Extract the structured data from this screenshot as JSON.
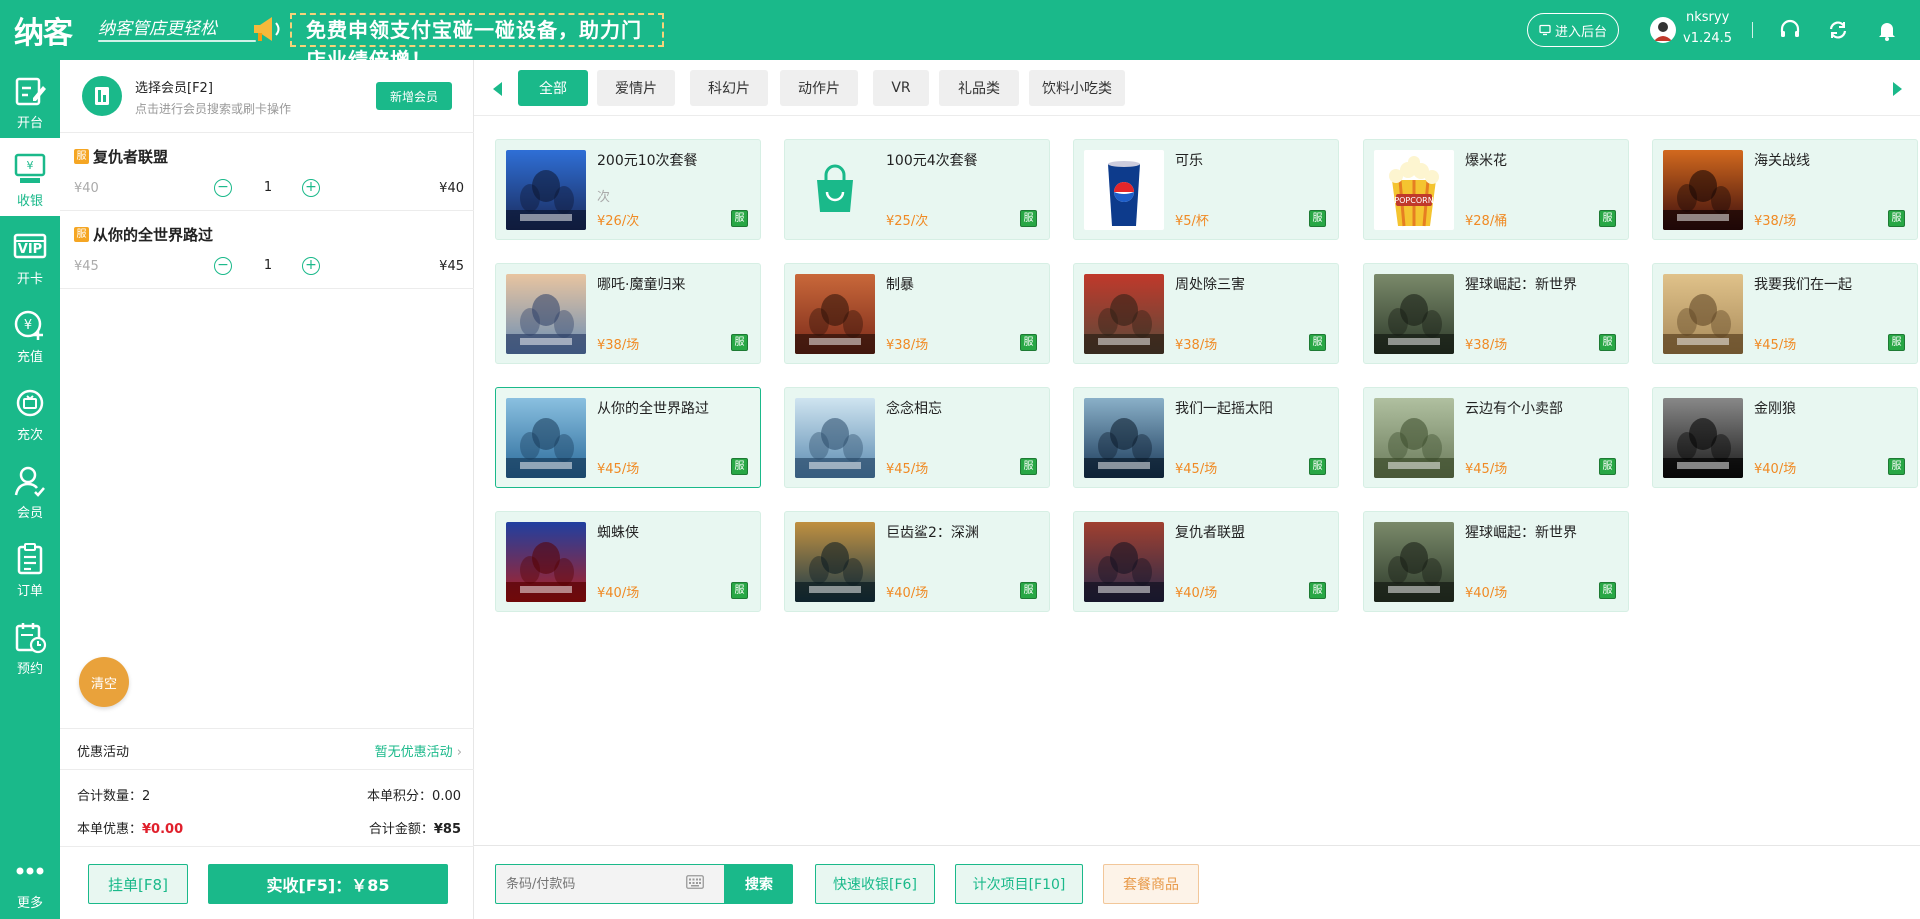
{
  "header": {
    "logo": "纳客",
    "slogan": "纳客管店更轻松",
    "banner": "免费申领支付宝碰一碰设备，助力门店业绩倍增！",
    "admin_button": "进入后台",
    "user_name": "nksryy",
    "version": "v1.24.5"
  },
  "sidebar": {
    "items": [
      {
        "label": "开台",
        "icon": "edit-icon"
      },
      {
        "label": "收银",
        "icon": "cashier-icon"
      },
      {
        "label": "开卡",
        "icon": "vip-icon"
      },
      {
        "label": "充值",
        "icon": "recharge-icon"
      },
      {
        "label": "充次",
        "icon": "recharge-count-icon"
      },
      {
        "label": "会员",
        "icon": "member-icon"
      },
      {
        "label": "订单",
        "icon": "order-icon"
      },
      {
        "label": "预约",
        "icon": "reservation-icon"
      },
      {
        "label": "更多",
        "icon": "more-icon"
      }
    ]
  },
  "cart": {
    "member_title": "选择会员[F2]",
    "member_sub": "点击进行会员搜索或刷卡操作",
    "add_member": "新增会员",
    "badge": "服",
    "items": [
      {
        "name": "复仇者联盟",
        "orig": "¥40",
        "qty": "1",
        "total": "¥40"
      },
      {
        "name": "从你的全世界路过",
        "orig": "¥45",
        "qty": "1",
        "total": "¥45"
      }
    ],
    "clear": "清空",
    "promo_label": "优惠活动",
    "promo_value": "暂无优惠活动",
    "total_qty_label": "合计数量：",
    "total_qty": "2",
    "points_label": "本单积分：",
    "points": "0.00",
    "discount_label": "本单优惠：",
    "discount": "¥0.00",
    "amount_label": "合计金额：",
    "amount": "¥85",
    "hold_button": "挂单[F8]",
    "pay_button": "实收[F5]：￥85"
  },
  "tabs": [
    "全部",
    "爱情片",
    "科幻片",
    "动作片",
    "VR",
    "礼品类",
    "饮料小吃类"
  ],
  "products": [
    {
      "name": "200元10次套餐",
      "sub": "次",
      "price": "¥26/次",
      "img": "arcade"
    },
    {
      "name": "100元4次套餐",
      "sub": "",
      "price": "¥25/次",
      "img": "bag"
    },
    {
      "name": "可乐",
      "sub": "",
      "price": "¥5/杯",
      "img": "cola"
    },
    {
      "name": "爆米花",
      "sub": "",
      "price": "¥28/桶",
      "img": "popcorn"
    },
    {
      "name": "海关战线",
      "sub": "",
      "price": "¥38/场",
      "img": "poster1"
    },
    {
      "name": "哪吒·魔童归来",
      "sub": "",
      "price": "¥38/场",
      "img": "poster2"
    },
    {
      "name": "制暴",
      "sub": "",
      "price": "¥38/场",
      "img": "poster3"
    },
    {
      "name": "周处除三害",
      "sub": "",
      "price": "¥38/场",
      "img": "poster4"
    },
    {
      "name": "猩球崛起：新世界",
      "sub": "",
      "price": "¥38/场",
      "img": "poster5"
    },
    {
      "name": "我要我们在一起",
      "sub": "",
      "price": "¥45/场",
      "img": "poster6"
    },
    {
      "name": "从你的全世界路过",
      "sub": "",
      "price": "¥45/场",
      "img": "poster7"
    },
    {
      "name": "念念相忘",
      "sub": "",
      "price": "¥45/场",
      "img": "poster8"
    },
    {
      "name": "我们一起摇太阳",
      "sub": "",
      "price": "¥45/场",
      "img": "poster9"
    },
    {
      "name": "云边有个小卖部",
      "sub": "",
      "price": "¥45/场",
      "img": "poster10"
    },
    {
      "name": "金刚狼",
      "sub": "",
      "price": "¥40/场",
      "img": "poster11"
    },
    {
      "name": "蜘蛛侠",
      "sub": "",
      "price": "¥40/场",
      "img": "poster12"
    },
    {
      "name": "巨齿鲨2：深渊",
      "sub": "",
      "price": "¥40/场",
      "img": "poster13"
    },
    {
      "name": "复仇者联盟",
      "sub": "",
      "price": "¥40/场",
      "img": "poster14"
    },
    {
      "name": "猩球崛起：新世界",
      "sub": "",
      "price": "¥40/场",
      "img": "poster5"
    }
  ],
  "product_badge": "服",
  "bottom": {
    "search_placeholder": "条码/付款码",
    "search_button": "搜索",
    "quick_cashier": "快速收银[F6]",
    "count_items": "计次项目[F10]",
    "package_goods": "套餐商品"
  },
  "colors": {
    "brand": "#1ab98a",
    "price": "#f08a24",
    "discount": "#e0202c"
  }
}
